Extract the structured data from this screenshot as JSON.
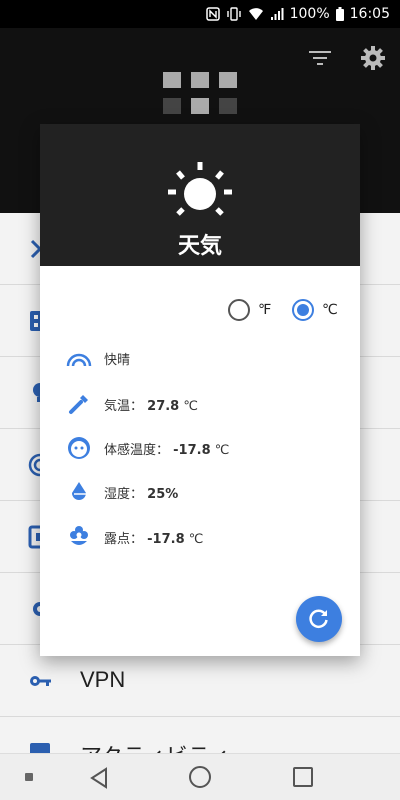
{
  "status_bar": {
    "battery_percent": "100%",
    "time": "16:05",
    "icons": [
      "nfc-icon",
      "vibrate-icon",
      "wifi-icon",
      "signal-icon",
      "battery-icon"
    ]
  },
  "background_list": {
    "items": [
      {
        "label": "",
        "icon": "close-icon"
      },
      {
        "label": "",
        "icon": "grid-icon"
      },
      {
        "label": "",
        "icon": "bulb-icon"
      },
      {
        "label": "",
        "icon": "target-icon"
      },
      {
        "label": "",
        "icon": "device-icon"
      },
      {
        "label": "",
        "icon": "settings-icon"
      },
      {
        "label": "VPN",
        "icon": "key-icon"
      },
      {
        "label": "アクティビティ",
        "icon": "activity-icon"
      }
    ]
  },
  "dialog": {
    "title": "天気",
    "units": {
      "fahrenheit_label": "℉",
      "celsius_label": "℃",
      "selected": "celsius"
    },
    "rows": [
      {
        "label": "快晴",
        "value": "",
        "icon": "rainbow-icon"
      },
      {
        "label": "気温：",
        "value": "27.8",
        "unit": "℃",
        "icon": "thermometer-icon"
      },
      {
        "label": "体感温度：",
        "value": "-17.8",
        "unit": "℃",
        "icon": "face-icon"
      },
      {
        "label": "湿度：",
        "value": "25%",
        "unit": "",
        "icon": "drop-icon"
      },
      {
        "label": "露点：",
        "value": "-17.8",
        "unit": "℃",
        "icon": "flower-icon"
      }
    ]
  },
  "colors": {
    "accent": "#3d7fe0",
    "header_dark": "#222222"
  }
}
